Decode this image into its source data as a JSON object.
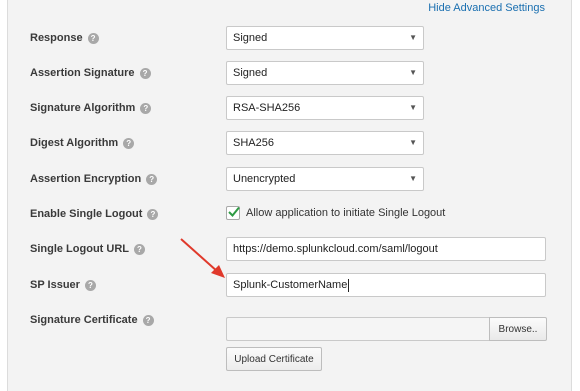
{
  "header": {
    "hide_advanced_label": "Hide Advanced Settings"
  },
  "fields": {
    "response": {
      "label": "Response",
      "value": "Signed"
    },
    "assertion_signature": {
      "label": "Assertion Signature",
      "value": "Signed"
    },
    "signature_algorithm": {
      "label": "Signature Algorithm",
      "value": "RSA-SHA256"
    },
    "digest_algorithm": {
      "label": "Digest Algorithm",
      "value": "SHA256"
    },
    "assertion_encryption": {
      "label": "Assertion Encryption",
      "value": "Unencrypted"
    },
    "enable_single_logout": {
      "label": "Enable Single Logout",
      "checkbox_label": "Allow application to initiate Single Logout",
      "checked": true
    },
    "single_logout_url": {
      "label": "Single Logout URL",
      "value": "https://demo.splunkcloud.com/saml/logout"
    },
    "sp_issuer": {
      "label": "SP Issuer",
      "value": "Splunk-CustomerName"
    },
    "signature_certificate": {
      "label": "Signature Certificate",
      "browse_label": "Browse..",
      "upload_label": "Upload Certificate"
    }
  },
  "icons": {
    "help": "question-mark-icon",
    "caret": "caret-down-icon",
    "check": "checkmark-icon",
    "annotation": "red-arrow-icon"
  },
  "colors": {
    "link": "#1a6fb0",
    "check": "#2e9b44",
    "arrow": "#e0392b",
    "panel_bg": "#f3f3f3"
  }
}
